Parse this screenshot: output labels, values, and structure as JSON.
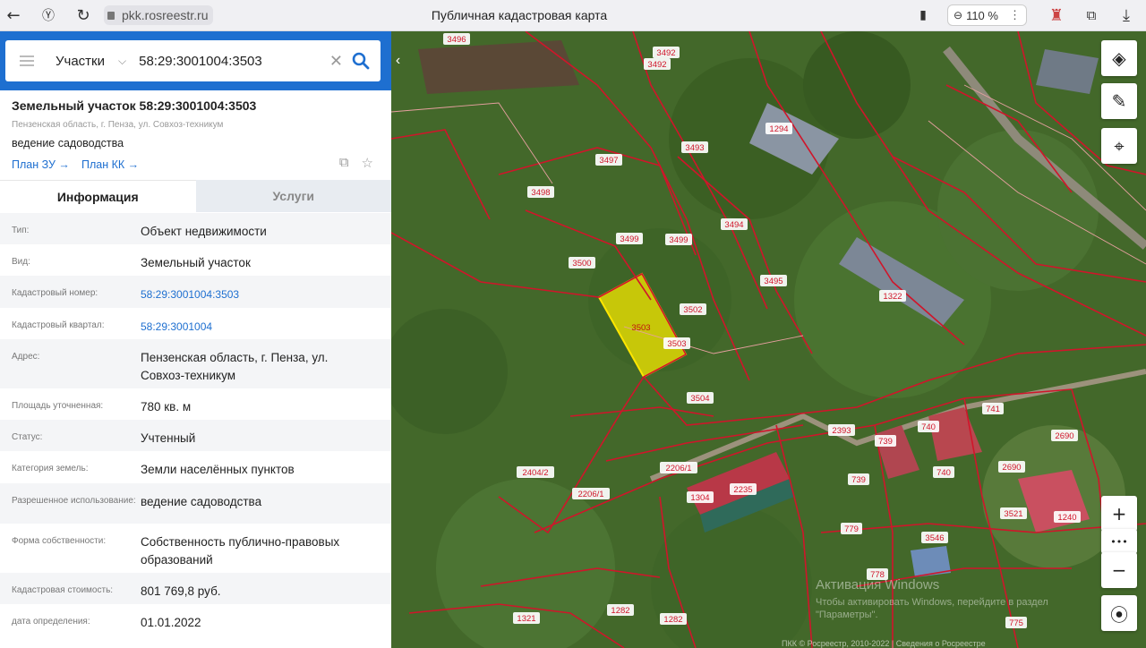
{
  "browser": {
    "url": "pkk.rosreestr.ru",
    "title": "Публичная кадастровая карта",
    "zoom": "110 %"
  },
  "search": {
    "type": "Участки",
    "value": "58:29:3001004:3503"
  },
  "object": {
    "title": "Земельный участок 58:29:3001004:3503",
    "address": "Пензенская область, г. Пенза, ул. Совхоз-техникум",
    "use": "ведение садоводства",
    "plan_zu": "План ЗУ →",
    "plan_kk": "План КК →"
  },
  "tabs": {
    "info": "Информация",
    "services": "Услуги"
  },
  "info_rows": [
    {
      "label": "Тип:",
      "value": "Объект недвижимости"
    },
    {
      "label": "Вид:",
      "value": "Земельный участок"
    },
    {
      "label": "Кадастровый номер:",
      "value": "58:29:3001004:3503"
    },
    {
      "label": "Кадастровый квартал:",
      "value": "58:29:3001004"
    },
    {
      "label": "Адрес:",
      "value": "Пензенская область, г. Пенза, ул. Совхоз-техникум"
    },
    {
      "label": "Площадь уточненная:",
      "value": "780 кв. м"
    },
    {
      "label": "Статус:",
      "value": "Учтенный"
    },
    {
      "label": "Категория земель:",
      "value": "Земли населённых пунктов"
    },
    {
      "label": "Разрешенное использование:",
      "value": "ведение садоводства"
    },
    {
      "label": "Форма собственности:",
      "value": "Собственность публично-правовых образований"
    },
    {
      "label": "Кадастровая стоимость:",
      "value": "801 769,8 руб."
    },
    {
      "label": "дата определения:",
      "value": "01.01.2022"
    }
  ],
  "map": {
    "watermark_title": "Активация Windows",
    "watermark_text": "Чтобы активировать Windows, перейдите в раздел \"Параметры\".",
    "copyright": "ПКК © Росреестр, 2010-2022 | Сведения о Росреестре",
    "parcels": [
      "3496",
      "3492",
      "3492",
      "1294",
      "3493",
      "3497",
      "3498",
      "3499",
      "3499",
      "3494",
      "3500",
      "3495",
      "1322",
      "3503",
      "3502",
      "3503",
      "3504",
      "741",
      "2393",
      "740",
      "739",
      "2690",
      "2690",
      "740",
      "739",
      "2206/1",
      "2404/2",
      "2206/1",
      "1304",
      "2235",
      "3521",
      "779",
      "3546",
      "778",
      "1321",
      "1282",
      "1282",
      "775",
      "1240"
    ],
    "controls": {
      "zoom_in": "+",
      "more": "•••",
      "zoom_out": "−"
    }
  },
  "colors": {
    "accent": "#1e6fd0",
    "parcel_line": "#d0152a",
    "selected": "#f5e800"
  }
}
